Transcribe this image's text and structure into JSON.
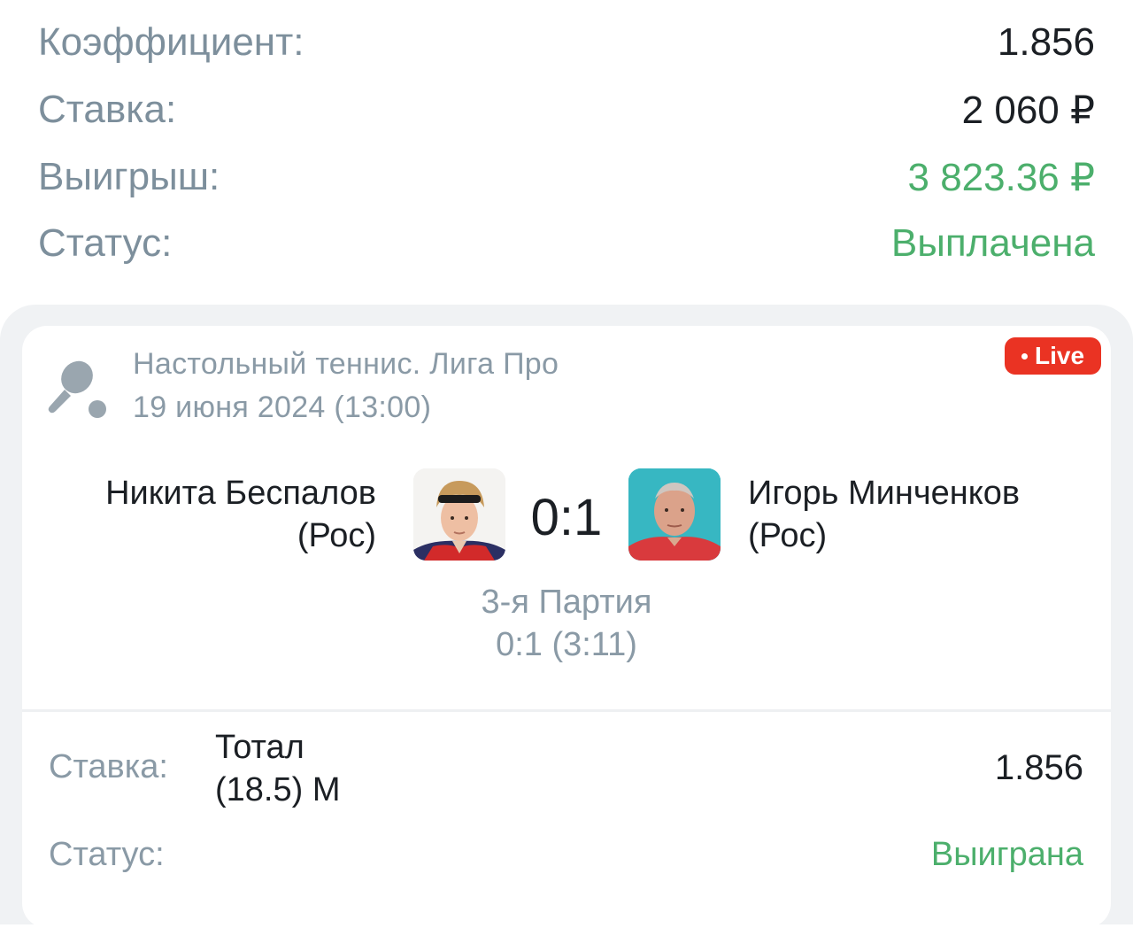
{
  "summary": {
    "coefficient": {
      "label": "Коэффициент:",
      "value": "1.856"
    },
    "stake": {
      "label": "Ставка:",
      "value": "2 060 ₽"
    },
    "winnings": {
      "label": "Выигрыш:",
      "value": "3 823.36 ₽"
    },
    "status": {
      "label": "Статус:",
      "value": "Выплачена"
    }
  },
  "event": {
    "sport_icon": "table-tennis-icon",
    "league": "Настольный теннис. Лига Про",
    "date": "19 июня 2024 (13:00)",
    "live_badge": "Live",
    "team1": {
      "name": "Никита Беспалов",
      "country": "(Рос)"
    },
    "team2": {
      "name": "Игорь Минченков",
      "country": "(Рос)"
    },
    "score": "0:1",
    "period": "3-я Партия",
    "period_score": "0:1 (3:11)"
  },
  "bet": {
    "label": "Ставка:",
    "market_line1": "Тотал",
    "market_line2": "(18.5) М",
    "odds": "1.856",
    "status_label": "Статус:",
    "status": "Выиграна"
  },
  "colors": {
    "green": "#4caf6c",
    "live_red": "#ea3323",
    "label_gray": "#7d8f9c"
  }
}
